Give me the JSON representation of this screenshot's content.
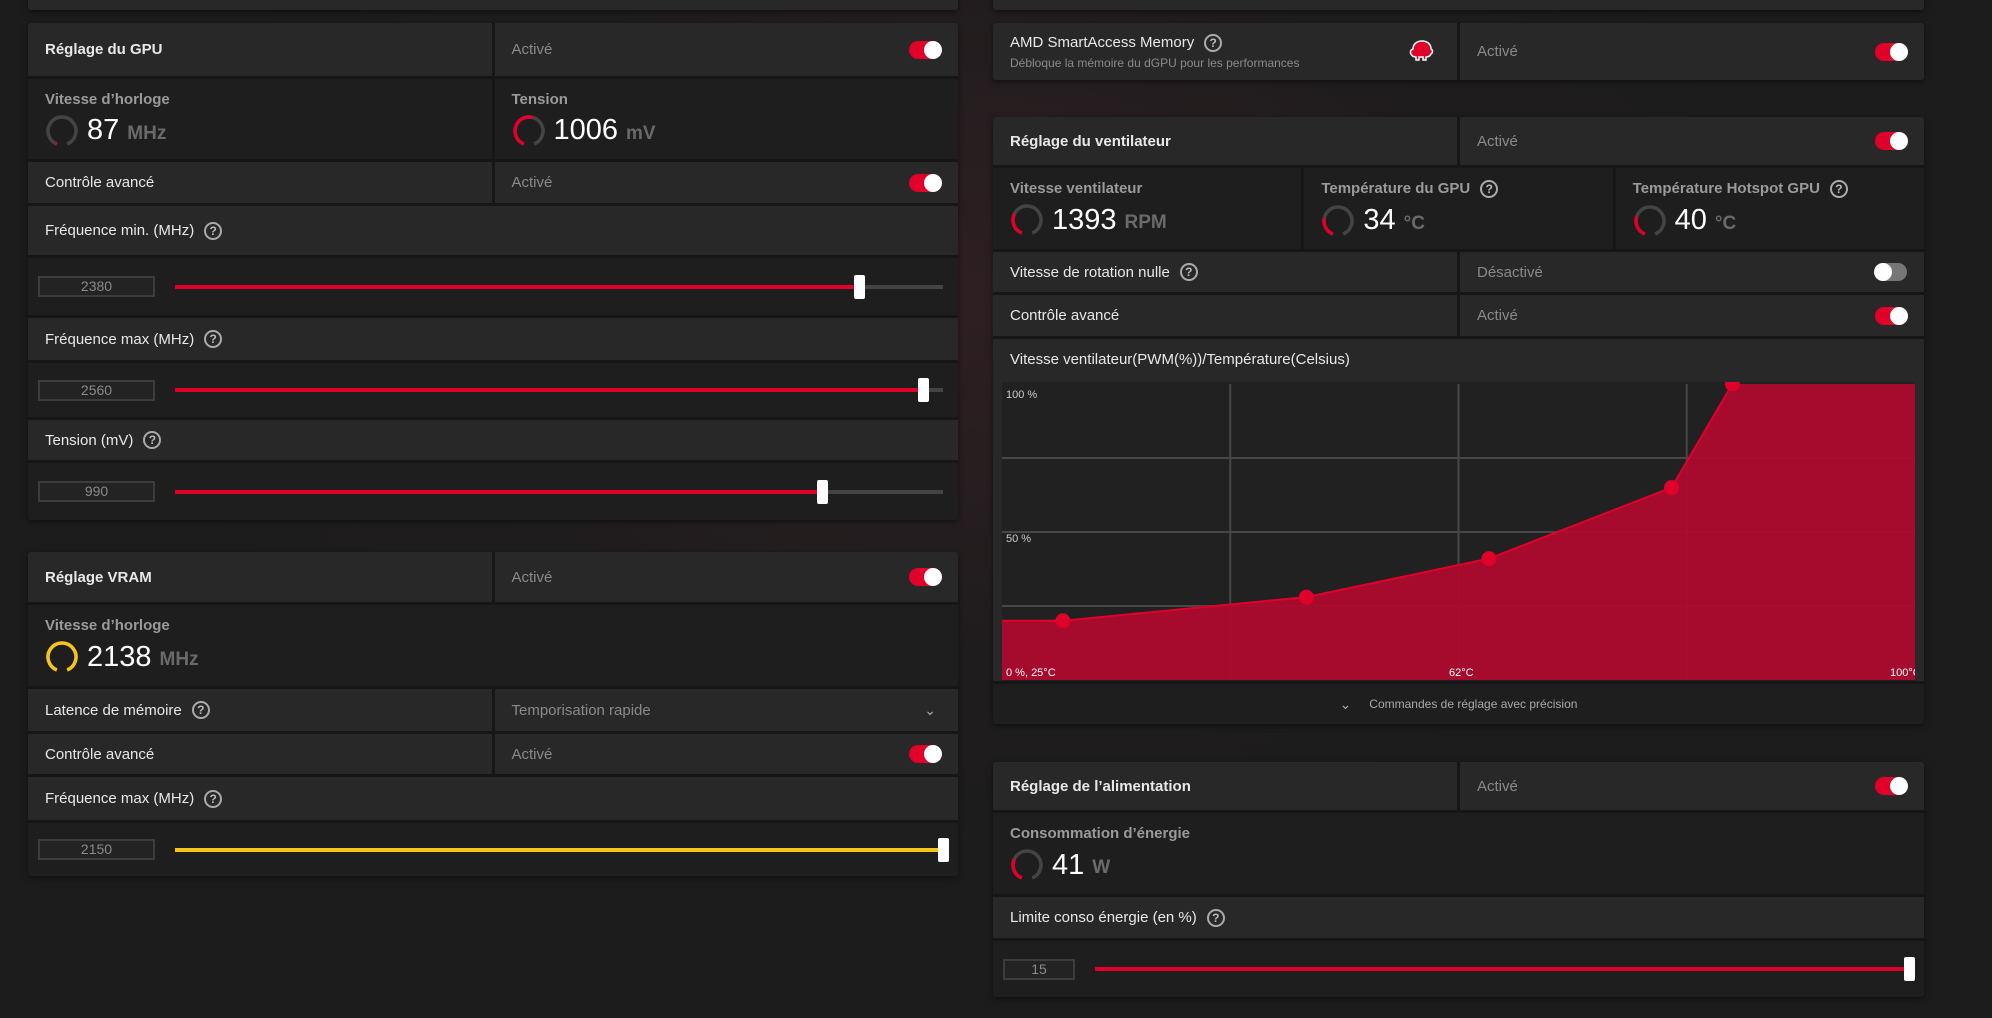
{
  "colors": {
    "accent": "#e0002a",
    "vram_accent": "#f5c518",
    "chart_fill": "#ae0a2e"
  },
  "gpu": {
    "title": "Réglage du GPU",
    "state": "Activé",
    "enabled": true,
    "clock": {
      "label": "Vitesse d’horloge",
      "value": "87",
      "unit": "MHz",
      "gauge": 0.02
    },
    "voltage": {
      "label": "Tension",
      "value": "1006",
      "unit": "mV",
      "gauge": 0.55
    },
    "advanced": {
      "label": "Contrôle avancé",
      "state": "Activé",
      "enabled": true
    },
    "min_freq": {
      "label": "Fréquence min. (MHz)",
      "value": "2380",
      "level": 0.89
    },
    "max_freq": {
      "label": "Fréquence max (MHz)",
      "value": "2560",
      "level": 0.974
    },
    "tension": {
      "label": "Tension (mV)",
      "value": "990",
      "level": 0.843
    }
  },
  "vram": {
    "title": "Réglage VRAM",
    "state": "Activé",
    "enabled": true,
    "clock": {
      "label": "Vitesse d’horloge",
      "value": "2138",
      "unit": "MHz",
      "gauge": 1.0
    },
    "latency": {
      "label": "Latence de mémoire",
      "value": "Temporisation rapide"
    },
    "advanced": {
      "label": "Contrôle avancé",
      "state": "Activé",
      "enabled": true
    },
    "max_freq": {
      "label": "Fréquence max (MHz)",
      "value": "2150",
      "level": 1.0
    }
  },
  "sam": {
    "title": "AMD SmartAccess Memory",
    "subtitle": "Débloque la mémoire du dGPU pour les performances",
    "state": "Activé",
    "enabled": true,
    "icon": "brain-icon"
  },
  "fan": {
    "title": "Réglage du ventilateur",
    "state": "Activé",
    "enabled": true,
    "speed": {
      "label": "Vitesse ventilateur",
      "value": "1393",
      "unit": "RPM",
      "gauge": 0.3
    },
    "gpu_temp": {
      "label": "Température du GPU",
      "value": "34",
      "unit": "°C",
      "gauge": 0.25
    },
    "hotspot": {
      "label": "Température Hotspot GPU",
      "value": "40",
      "unit": "°C",
      "gauge": 0.28
    },
    "zero_rpm": {
      "label": "Vitesse de rotation nulle",
      "state": "Désactivé",
      "enabled": false
    },
    "advanced": {
      "label": "Contrôle avancé",
      "state": "Activé",
      "enabled": true
    },
    "chart_title": "Vitesse ventilateur(PWM(%))/Température(Celsius)",
    "footer": "Commandes de réglage avec précision"
  },
  "chart_data": {
    "type": "area",
    "title": "Vitesse ventilateur(PWM(%))/Température(Celsius)",
    "x": [
      30,
      50,
      65,
      80,
      85
    ],
    "y": [
      20,
      28,
      41,
      65,
      100
    ],
    "xlim": [
      25,
      100
    ],
    "ylim": [
      0,
      100
    ],
    "tick_labels": {
      "y_top": "100 %",
      "y_mid": "50 %",
      "origin": "0 %, 25°C",
      "x_mid": "62°C",
      "x_max": "100°C"
    },
    "grid": true
  },
  "power": {
    "title": "Réglage de l’alimentation",
    "state": "Activé",
    "enabled": true,
    "consumption": {
      "label": "Consommation d’énergie",
      "value": "41",
      "unit": "W",
      "gauge": 0.3
    },
    "limit": {
      "label": "Limite conso énergie (en %)",
      "value": "15",
      "level": 1.0
    }
  }
}
